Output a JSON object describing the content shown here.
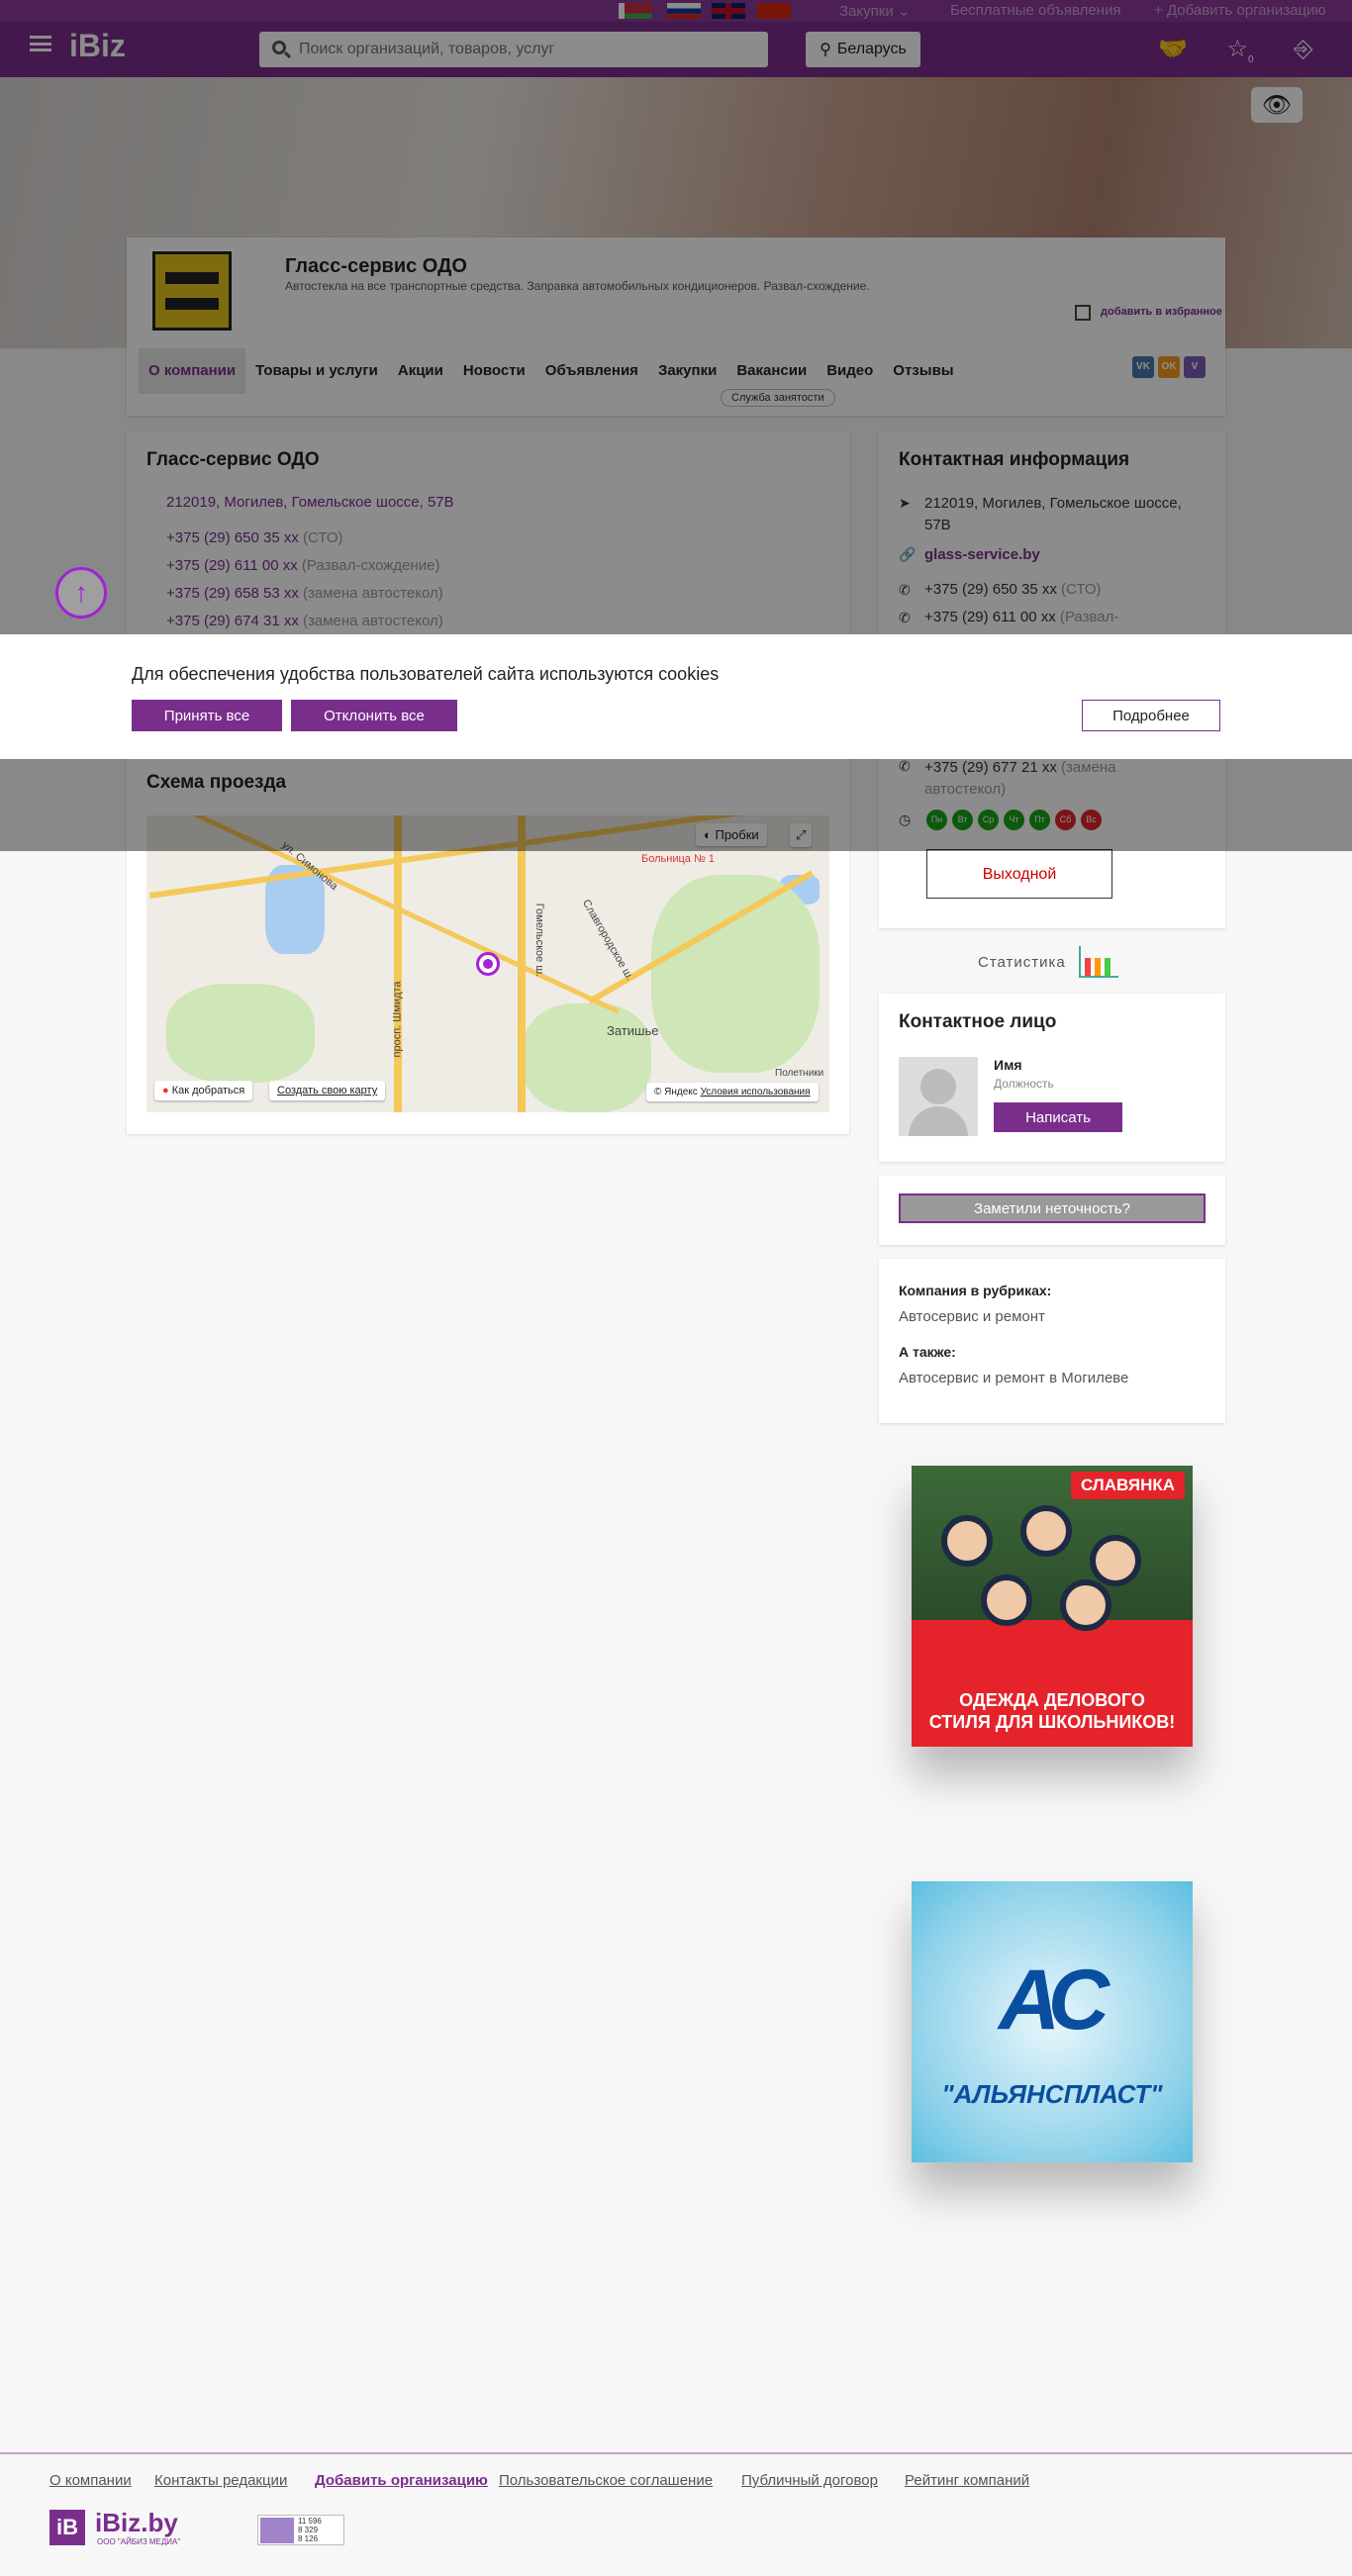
{
  "header": {
    "top_links": [
      "Закупки",
      "Бесплатные объявления",
      "Добавить организацию"
    ],
    "logo": "iBiz",
    "search_placeholder": "Поиск организаций, товаров, услуг",
    "region": "Беларусь",
    "favorites_count": "0"
  },
  "company": {
    "name": "Гласс-сервис ОДО",
    "slogan": "Автостекла на все транспортные средства. Заправка автомобильных кондиционеров. Развал-схождение.",
    "favorite_label": "добавить в избранное",
    "tabs": [
      "О компании",
      "Товары и услуги",
      "Акции",
      "Новости",
      "Объявления",
      "Закупки",
      "Вакансии",
      "Видео",
      "Отзывы"
    ],
    "busy_badge": "Служба занятости"
  },
  "about": {
    "title": "Гласс-сервис ОДО",
    "address": "212019, Могилев, Гомельское шоссе, 57В",
    "phones": [
      {
        "number": "+375 (29) 650 35 xx",
        "note": "(СТО)"
      },
      {
        "number": "+375 (29) 611 00 xx",
        "note": "(Развал-схождение)"
      },
      {
        "number": "+375 (29) 658 53 xx",
        "note": "(замена автостекол)"
      },
      {
        "number": "+375 (29) 674 31 xx",
        "note": "(замена автостекол)"
      }
    ]
  },
  "map": {
    "title": "Схема проезда",
    "traffic_button": "Пробки",
    "route_button": "Как добраться",
    "create_map": "Создать свою карту",
    "copyright": "© Яндекс",
    "terms": "Условия использования",
    "labels": [
      "Затишье",
      "Гомельское ш.",
      "Больница № 1",
      "Полетники",
      "просп. Шмидта",
      "ул. Симонова",
      "Славгородское ш."
    ]
  },
  "contact_info": {
    "title": "Контактная информация",
    "address": "212019, Могилев, Гомельское шоссе, 57В",
    "website": "glass-service.by",
    "phones": [
      {
        "number": "+375 (29) 650 35 xx",
        "note": "(СТО)"
      },
      {
        "number": "+375 (29) 611 00 xx",
        "note": "(Развал-"
      },
      {
        "number": "+375 (29) 677 21 xx",
        "note": "(замена автостекол)"
      }
    ],
    "days": [
      "Пн",
      "Вт",
      "Ср",
      "Чт",
      "Пт",
      "Сб",
      "Вс"
    ],
    "status": "Выходной"
  },
  "stats_label": "Статистика",
  "contact_person": {
    "title": "Контактное лицо",
    "name": "Имя",
    "position": "Должность",
    "write_button": "Написать"
  },
  "report_button": "Заметили неточность?",
  "rubrics": {
    "title": "Компания в рубриках:",
    "item": "Автосервис и ремонт",
    "also_title": "А также:",
    "also_item": "Автосервис и ремонт в Могилеве"
  },
  "ads": {
    "ad1_brand": "СЛАВЯНКА",
    "ad1_line1": "ОДЕЖДА ДЕЛОВОГО",
    "ad1_line2": "СТИЛЯ ДЛЯ ШКОЛЬНИКОВ!",
    "ad2_logo": "АС",
    "ad2_name": "\"АЛЬЯНСПЛАСТ\""
  },
  "cookie": {
    "text": "Для обеспечения удобства пользователей сайта используются cookies",
    "accept": "Принять все",
    "decline": "Отклонить все",
    "more": "Подробнее"
  },
  "footer": {
    "links": [
      "О компании",
      "Контакты редакции",
      "Добавить организацию",
      "Пользовательское соглашение",
      "Публичный договор",
      "Рейтинг компаний"
    ],
    "logo_mark": "iB",
    "logo_text": "iBiz.by",
    "logo_sub": "ООО \"АЙБИЗ МЕДИА\"",
    "counter_lines": [
      "11 596",
      "8 329",
      "8 126"
    ]
  }
}
